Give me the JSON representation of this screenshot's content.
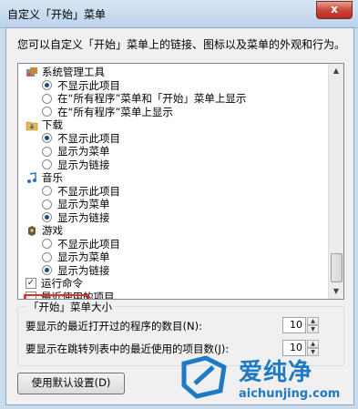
{
  "window": {
    "title": "自定义「开始」菜单",
    "close_glyph": "x"
  },
  "description": "您可以自定义「开始」菜单上的链接、图标以及菜单的外观和行为。",
  "list": {
    "items": [
      {
        "kind": "category",
        "label": "系统管理工具",
        "icon": "admin-tools-icon"
      },
      {
        "kind": "radio",
        "label": "不显示此项目",
        "checked": true
      },
      {
        "kind": "radio",
        "label": "在“所有程序”菜单和「开始」菜单上显示",
        "checked": false
      },
      {
        "kind": "radio",
        "label": "在“所有程序”菜单上显示",
        "checked": false
      },
      {
        "kind": "category",
        "label": "下载",
        "icon": "downloads-folder-icon"
      },
      {
        "kind": "radio",
        "label": "不显示此项目",
        "checked": true
      },
      {
        "kind": "radio",
        "label": "显示为菜单",
        "checked": false
      },
      {
        "kind": "radio",
        "label": "显示为链接",
        "checked": false
      },
      {
        "kind": "category",
        "label": "音乐",
        "icon": "music-note-icon"
      },
      {
        "kind": "radio",
        "label": "不显示此项目",
        "checked": false
      },
      {
        "kind": "radio",
        "label": "显示为菜单",
        "checked": false
      },
      {
        "kind": "radio",
        "label": "显示为链接",
        "checked": true
      },
      {
        "kind": "category",
        "label": "游戏",
        "icon": "games-icon"
      },
      {
        "kind": "radio",
        "label": "不显示此项目",
        "checked": false
      },
      {
        "kind": "radio",
        "label": "显示为菜单",
        "checked": false
      },
      {
        "kind": "radio",
        "label": "显示为链接",
        "checked": true
      },
      {
        "kind": "checkbox",
        "label": "运行命令",
        "checked": true
      },
      {
        "kind": "checkbox",
        "label": "最近使用的项目",
        "checked": false
      }
    ]
  },
  "size_group": {
    "title": "「开始」菜单大小",
    "recent_programs_label": "要显示的最近打开过的程序的数目(N):",
    "recent_programs_value": "10",
    "jumplist_label": "要显示在跳转列表中的最近使用的项目数(J):",
    "jumplist_value": "10"
  },
  "default_button_label": "使用默认设置(D)",
  "watermark": {
    "brand": "爱纯净",
    "url": "aichunjing.com"
  },
  "colors": {
    "highlight": "#e0302a",
    "brand": "#1f79c3"
  }
}
